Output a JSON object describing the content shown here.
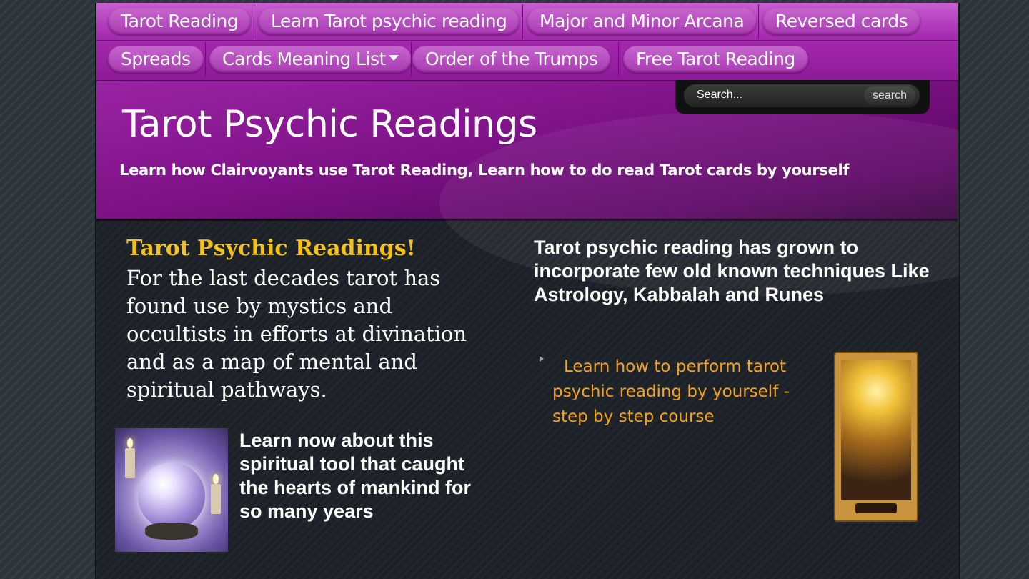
{
  "nav": {
    "row1": [
      "Tarot Reading",
      "Learn Tarot psychic reading",
      "Major and Minor Arcana",
      "Reversed cards"
    ],
    "row2": [
      "Spreads",
      "Cards Meaning List",
      "Order of the Trumps",
      "Free Tarot Reading"
    ]
  },
  "search": {
    "placeholder": "Search...",
    "button": "search"
  },
  "header": {
    "title": "Tarot Psychic Readings",
    "subtitle": "Learn how Clairvoyants use Tarot Reading, Learn how to do read Tarot cards by yourself"
  },
  "left": {
    "heading": "Tarot Psychic Readings!",
    "paragraph": "For the last decades tarot has found use by mystics and occultists in efforts at divination and as a map of mental and spiritual pathways.",
    "caption": "Learn now about this spiritual tool that caught the hearts of mankind for so many years"
  },
  "right": {
    "heading": "Tarot psychic reading has grown to incorporate few old known techniques Like Astrology, Kabbalah and Runes",
    "link": "Learn how to perform tarot psychic reading by yourself - step by step course"
  }
}
